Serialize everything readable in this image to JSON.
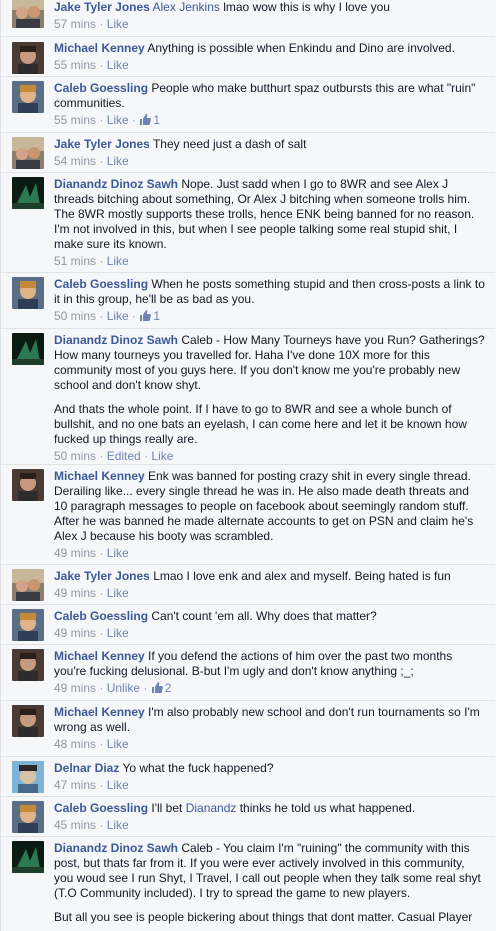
{
  "comments": [
    {
      "author": "Jake Tyler Jones",
      "segments": [
        {
          "t": "link",
          "v": "Alex Jenkins"
        },
        {
          "t": "text",
          "v": " lmao wow this is why I love you"
        }
      ],
      "time": "57 mins",
      "actions": [
        "Like"
      ],
      "likes": ""
    },
    {
      "author": "Michael Kenney",
      "text": "Anything is possible when Enkindu and Dino are involved.",
      "time": "55 mins",
      "actions": [
        "Like"
      ],
      "likes": ""
    },
    {
      "author": "Caleb Goessling",
      "text": "People who make butthurt spaz outbursts this are what \"ruin\" communities.",
      "time": "55 mins",
      "actions": [
        "Like"
      ],
      "likes": "1"
    },
    {
      "author": "Jake Tyler Jones",
      "text": "They need just a dash of salt",
      "time": "54 mins",
      "actions": [
        "Like"
      ],
      "likes": ""
    },
    {
      "author": "Dianandz Dinoz Sawh",
      "text": "Nope. Just sadd when I go to 8WR and see Alex J threads bitching about something, Or Alex J bitching when someone trolls him. The 8WR mostly supports these trolls, hence ENK being banned for no reason. I'm not involved in this, but when I see people talking some real stupid shit, I make sure its known.",
      "time": "51 mins",
      "actions": [
        "Like"
      ],
      "likes": ""
    },
    {
      "author": "Caleb Goessling",
      "text": "When he posts something stupid and then cross-posts a link to it in this group, he'll be as bad as you.",
      "time": "50 mins",
      "actions": [
        "Like"
      ],
      "likes": "1"
    },
    {
      "author": "Dianandz Dinoz Sawh",
      "text": "Caleb - How Many Tourneys have you Run? Gatherings? How many tourneys you travelled for. Haha I've done 10X more for this community most of you guys here. If you don't know me you're probably new school and don't know shyt.",
      "text2": "And thats the whole point. If I have to go to 8WR and see a whole bunch of bullshit, and no one bats an eyelash, I can come here and let it be known how fucked up things really are.",
      "time": "50 mins",
      "actions": [
        "Edited",
        "Like"
      ],
      "likes": ""
    },
    {
      "author": "Michael Kenney",
      "text": "Enk was banned for posting crazy shit in every single thread. Derailing like... every single thread he was in. He also made death threats and 10 paragraph messages to people on facebook about seemingly random stuff. After he was banned he made alternate accounts to get on PSN and claim he's Alex J because his booty was scrambled.",
      "time": "49 mins",
      "actions": [
        "Like"
      ],
      "likes": ""
    },
    {
      "author": "Jake Tyler Jones",
      "text": "Lmao I love enk and alex and myself. Being hated is fun",
      "time": "49 mins",
      "actions": [
        "Like"
      ],
      "likes": ""
    },
    {
      "author": "Caleb Goessling",
      "text": "Can't count 'em all. Why does that matter?",
      "time": "49 mins",
      "actions": [
        "Like"
      ],
      "likes": ""
    },
    {
      "author": "Michael Kenney",
      "text": "If you defend the actions of him over the past two months you're fucking delusional. B-but I'm ugly and don't know anything ;_;",
      "time": "49 mins",
      "actions": [
        "Unlike"
      ],
      "likes": "2"
    },
    {
      "author": "Michael Kenney",
      "text": "I'm also probably new school and don't run tournaments so I'm wrong as well.",
      "time": "48 mins",
      "actions": [
        "Like"
      ],
      "likes": ""
    },
    {
      "author": "Delnar Diaz",
      "text": "Yo what the fuck happened?",
      "time": "47 mins",
      "actions": [
        "Like"
      ],
      "likes": ""
    },
    {
      "author": "Caleb Goessling",
      "segments": [
        {
          "t": "text",
          "v": "I'll bet "
        },
        {
          "t": "link",
          "v": "Dianandz"
        },
        {
          "t": "text",
          "v": " thinks he told us what happened."
        }
      ],
      "time": "45 mins",
      "actions": [
        "Like"
      ],
      "likes": ""
    },
    {
      "author": "Dianandz Dinoz Sawh",
      "text": "Caleb - You claim I'm \"ruining\" the community with this post, but thats far from it. If you were ever actively involved in this community, you woud see I run Shyt, I Travel, I call out people when they talk some real shyt (T.O Community included). I try to spread the game to new players.",
      "text2": "But all you see is people bickering about things that dont matter. Casual Player",
      "time": "",
      "actions": [],
      "likes": ""
    }
  ],
  "colors": {
    "name": "#3b5998",
    "meta": "#9197a3",
    "action": "#6d84b4",
    "bg": "#f6f7f9",
    "divider": "#e1e2e3"
  }
}
